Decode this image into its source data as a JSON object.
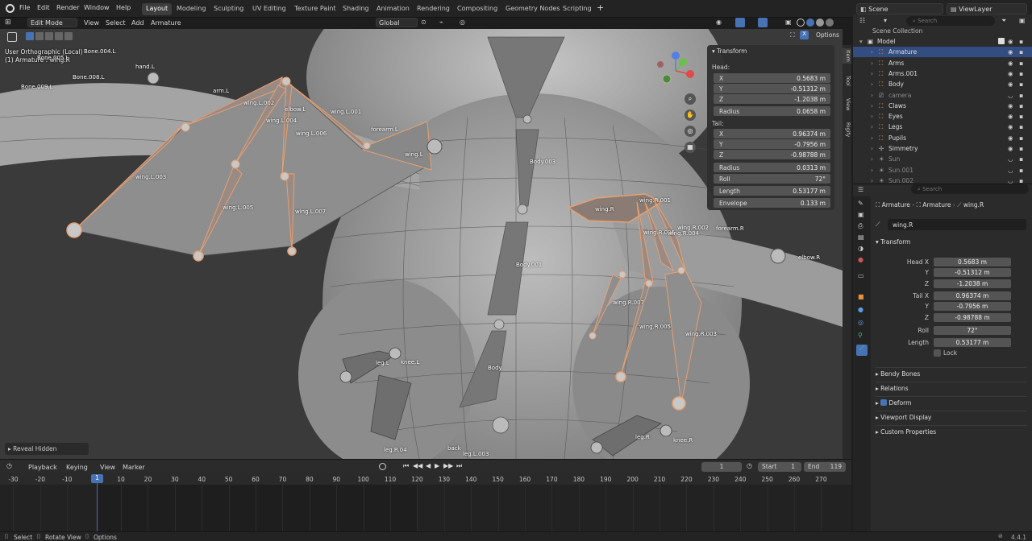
{
  "menu": [
    "File",
    "Edit",
    "Render",
    "Window",
    "Help"
  ],
  "workspaces": [
    "Layout",
    "Modeling",
    "Sculpting",
    "UV Editing",
    "Texture Paint",
    "Shading",
    "Animation",
    "Rendering",
    "Compositing",
    "Geometry Nodes",
    "Scripting"
  ],
  "active_workspace": "Layout",
  "scene": {
    "name": "Scene",
    "view_layer": "ViewLayer"
  },
  "viewport_header": {
    "mode": "Edit Mode",
    "menus": [
      "View",
      "Select",
      "Add",
      "Armature"
    ],
    "orientation": "Global",
    "options": "Options"
  },
  "viewport_info": {
    "view": "User Orthographic (Local)",
    "object": "(1) Armature : wing.R"
  },
  "reveal_hidden": "Reveal Hidden",
  "npanel": {
    "title": "Transform",
    "head_label": "Head:",
    "head": [
      {
        "k": "X",
        "v": "0.5683 m"
      },
      {
        "k": "Y",
        "v": "-0.51312 m"
      },
      {
        "k": "Z",
        "v": "-1.2038 m"
      },
      {
        "k": "Radius",
        "v": "0.0658 m"
      }
    ],
    "tail_label": "Tail:",
    "tail": [
      {
        "k": "X",
        "v": "0.96374 m"
      },
      {
        "k": "Y",
        "v": "-0.7956 m"
      },
      {
        "k": "Z",
        "v": "-0.98788 m"
      }
    ],
    "extra": [
      {
        "k": "Radius",
        "v": "0.0313 m"
      },
      {
        "k": "Roll",
        "v": "72°"
      },
      {
        "k": "Length",
        "v": "0.53177 m"
      },
      {
        "k": "Envelope",
        "v": "0.133 m"
      }
    ]
  },
  "vtabs": [
    "Item",
    "Tool",
    "View",
    "Rigify"
  ],
  "bones": [
    {
      "n": "Bone.004.L"
    },
    {
      "n": "Bone.005.L"
    },
    {
      "n": "hand.L"
    },
    {
      "n": "Bone.008.L"
    },
    {
      "n": "Bone.009.L"
    },
    {
      "n": "arm.L"
    },
    {
      "n": "wing.L.002"
    },
    {
      "n": "elbow.L"
    },
    {
      "n": "wing.L.001"
    },
    {
      "n": "wing.L.004"
    },
    {
      "n": "wing.L.006"
    },
    {
      "n": "forearm.L"
    },
    {
      "n": "wing.L"
    },
    {
      "n": "wing.L.003"
    },
    {
      "n": "wing.L.005"
    },
    {
      "n": "wing.L.007"
    },
    {
      "n": "Body.003"
    },
    {
      "n": "wing.R"
    },
    {
      "n": "wing.R.001"
    },
    {
      "n": "wing.R.006"
    },
    {
      "n": "wing.R.004"
    },
    {
      "n": "wing.R.002"
    },
    {
      "n": "forearm.R"
    },
    {
      "n": "elbow.R"
    },
    {
      "n": "Body.001"
    },
    {
      "n": "wing.R.007"
    },
    {
      "n": "wing.R.005"
    },
    {
      "n": "wing.R.003"
    },
    {
      "n": "leg.L"
    },
    {
      "n": "knee.L"
    },
    {
      "n": "Body"
    },
    {
      "n": "leg.R"
    },
    {
      "n": "knee.R"
    },
    {
      "n": "leg.R.04"
    },
    {
      "n": "back"
    },
    {
      "n": "leg.L.003"
    }
  ],
  "outliner": {
    "search_placeholder": "Search",
    "collection": "Scene Collection",
    "items": [
      {
        "name": "Model",
        "level": 0,
        "type": "collection"
      },
      {
        "name": "Armature",
        "level": 1,
        "type": "armature",
        "selected": true
      },
      {
        "name": "Arms",
        "level": 1,
        "type": "armature"
      },
      {
        "name": "Arms.001",
        "level": 1,
        "type": "armature"
      },
      {
        "name": "Body",
        "level": 1,
        "type": "armature"
      },
      {
        "name": "camera",
        "level": 1,
        "type": "camera",
        "dim": true
      },
      {
        "name": "Claws",
        "level": 1,
        "type": "armature"
      },
      {
        "name": "Eyes",
        "level": 1,
        "type": "armature"
      },
      {
        "name": "Legs",
        "level": 1,
        "type": "armature"
      },
      {
        "name": "Pupils",
        "level": 1,
        "type": "armature"
      },
      {
        "name": "Simmetry",
        "level": 1,
        "type": "empty"
      },
      {
        "name": "Sun",
        "level": 1,
        "type": "light",
        "dim": true
      },
      {
        "name": "Sun.001",
        "level": 1,
        "type": "light",
        "dim": true
      },
      {
        "name": "Sun.002",
        "level": 1,
        "type": "light",
        "dim": true
      }
    ]
  },
  "properties": {
    "search_placeholder": "Search",
    "breadcrumb": [
      "Armature",
      "Armature",
      "wing.R"
    ],
    "bone_name": "wing.R",
    "transform_title": "Transform",
    "fields": [
      {
        "k": "Head X",
        "v": "0.5683 m"
      },
      {
        "k": "Y",
        "v": "-0.51312 m"
      },
      {
        "k": "Z",
        "v": "-1.2038 m"
      },
      {
        "k": "Tail X",
        "v": "0.96374 m"
      },
      {
        "k": "Y",
        "v": "-0.7956 m"
      },
      {
        "k": "Z",
        "v": "-0.98788 m"
      },
      {
        "k": "Roll",
        "v": "72°"
      },
      {
        "k": "Length",
        "v": "0.53177 m"
      }
    ],
    "lock": "Lock",
    "panels": [
      "Bendy Bones",
      "Relations",
      "Deform",
      "Viewport Display",
      "Custom Properties"
    ]
  },
  "timeline": {
    "menus": [
      "Playback",
      "Keying",
      "View",
      "Marker"
    ],
    "current_frame": "1",
    "start_label": "Start",
    "start": "1",
    "end_label": "End",
    "end": "119",
    "ticks": [
      "-30",
      "-20",
      "-10",
      "1",
      "10",
      "20",
      "30",
      "40",
      "50",
      "60",
      "70",
      "80",
      "90",
      "100",
      "110",
      "120",
      "130",
      "140",
      "150",
      "160",
      "170",
      "180",
      "190",
      "200",
      "210",
      "220",
      "230",
      "240",
      "250",
      "260",
      "270"
    ]
  },
  "status": {
    "select": "Select",
    "rotate": "Rotate View",
    "options": "Options",
    "version": "4.4.1"
  },
  "colors": {
    "accent": "#4772b3",
    "selected_bone": "#e8a070",
    "viewport_bg": "#3a3a3a",
    "playhead": "#4772b3"
  }
}
